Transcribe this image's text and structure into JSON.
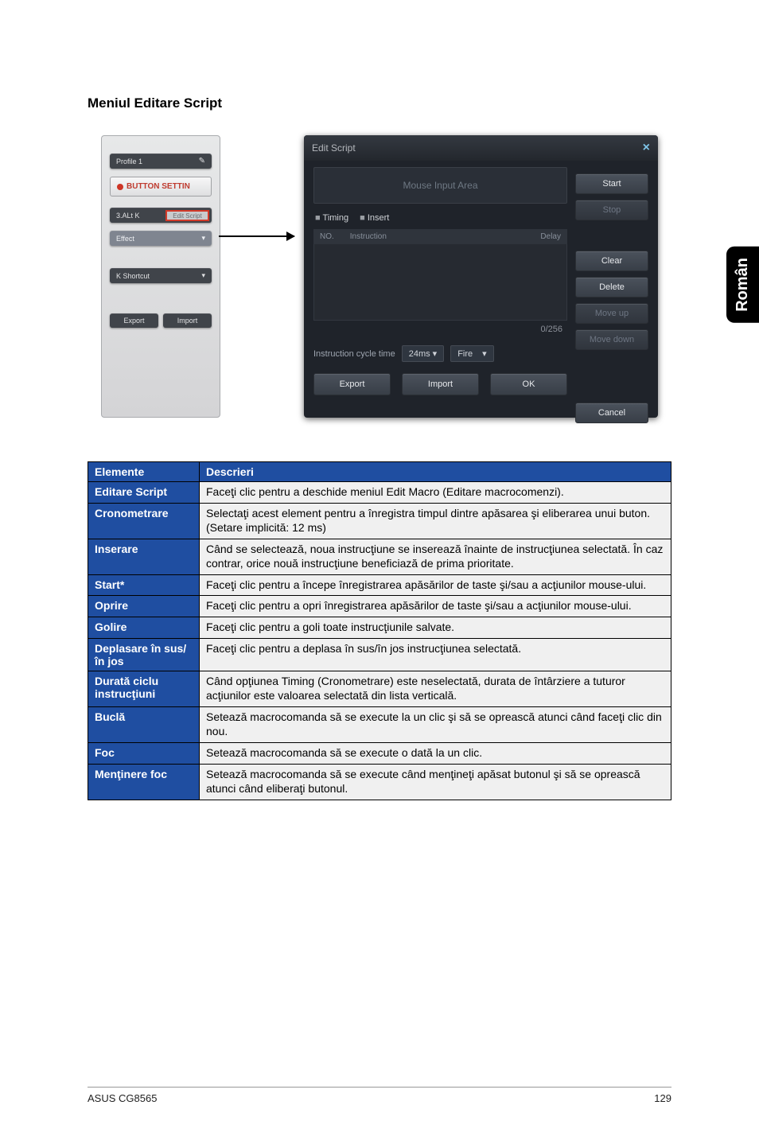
{
  "page": {
    "heading": "Meniul Editare Script",
    "side_tab": "Român",
    "footer_left": "ASUS CG8565",
    "footer_right": "129"
  },
  "left_panel": {
    "profile": "Profile 1",
    "button_setting": "BUTTON SETTIN",
    "slider": "3.ALt K",
    "highlight": "Edit Script",
    "effects": "Effect",
    "shortcut": "K Shortcut",
    "export": "Export",
    "import": "Import"
  },
  "dialog": {
    "title": "Edit Script",
    "close": "×",
    "input_area": "Mouse Input Area",
    "tabs": {
      "timing": "Timing",
      "insert": "Insert"
    },
    "cols": {
      "no": "NO.",
      "instruction": "Instruction",
      "delay": "Delay"
    },
    "counter": "0/256",
    "cycle_label": "Instruction cycle time",
    "cycle_value": "24ms ▾",
    "fire": "Fire",
    "fire_caret": "▾",
    "buttons": {
      "start": "Start",
      "stop": "Stop",
      "clear": "Clear",
      "delete": "Delete",
      "moveup": "Move up",
      "movedown": "Move down",
      "export": "Export",
      "import": "Import",
      "ok": "OK",
      "cancel": "Cancel"
    }
  },
  "table": {
    "headers": {
      "element": "Elemente",
      "desc": "Descrieri"
    },
    "rows": [
      {
        "label": "Editare Script",
        "text": "Faceţi clic pentru a deschide meniul Edit Macro (Editare macrocomenzi)."
      },
      {
        "label": "Cronometrare",
        "text": "Selectaţi acest element pentru a înregistra timpul dintre apăsarea şi eliberarea unui buton. (Setare implicită: 12 ms)"
      },
      {
        "label": "Inserare",
        "text": "Când se selectează, noua instrucţiune se inserează înainte de instrucţiunea selectată. În caz contrar, orice nouă instrucţiune beneficiază de prima prioritate."
      },
      {
        "label": "Start*",
        "text": "Faceţi clic pentru a începe înregistrarea apăsărilor de taste şi/sau a acţiunilor mouse-ului."
      },
      {
        "label": "Oprire",
        "text": "Faceţi clic pentru a opri înregistrarea apăsărilor de taste şi/sau a acţiunilor mouse-ului."
      },
      {
        "label": "Golire",
        "text": "Faceţi clic pentru a goli toate instrucţiunile salvate."
      },
      {
        "label": "Deplasare în sus/în jos",
        "text": "Faceţi clic pentru a deplasa în sus/în jos instrucţiunea selectată."
      },
      {
        "label": "Durată ciclu instrucţiuni",
        "text": "Când opţiunea Timing (Cronometrare) este neselectată, durata de întârziere a tuturor acţiunilor este valoarea selectată din lista verticală."
      },
      {
        "label": "Buclă",
        "text": "Setează macrocomanda să se execute la un clic şi să se oprească atunci când faceţi clic din nou."
      },
      {
        "label": "Foc",
        "text": "Setează macrocomanda să se execute o dată la un clic."
      },
      {
        "label": "Menţinere foc",
        "text": "Setează macrocomanda să se execute când menţineţi apăsat butonul şi să se oprească atunci când eliberaţi butonul."
      }
    ]
  }
}
